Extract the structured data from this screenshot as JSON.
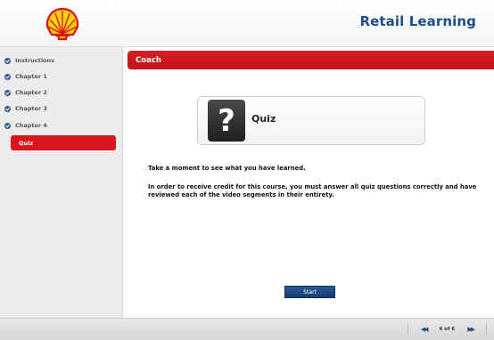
{
  "header": {
    "title": "Retail Learning",
    "brand_color": "#d9151b",
    "title_color": "#1d4f86"
  },
  "sidebar": {
    "items": [
      {
        "label": "Instructions",
        "icon": "check-icon"
      },
      {
        "label": "Chapter 1",
        "icon": "check-icon"
      },
      {
        "label": "Chapter 2",
        "icon": "check-icon"
      },
      {
        "label": "Chapter 3",
        "icon": "check-icon"
      },
      {
        "label": "Chapter 4",
        "icon": "check-icon"
      }
    ],
    "active": {
      "label": "Quiz"
    }
  },
  "main": {
    "section_title": "Coach",
    "quiz_card": {
      "icon": "question-mark-icon",
      "icon_glyph": "?",
      "label": "Quiz"
    },
    "intro_text": "Take a moment to see what you have learned.",
    "credit_text": "In order to receive credit for this course, you must answer all quiz questions correctly and have reviewed each of the video segments in their entirety.",
    "start_label": "Start"
  },
  "footer": {
    "prev_glyph": "◀◀",
    "page_indicator": "6 of 6",
    "next_glyph": "▶▶"
  }
}
